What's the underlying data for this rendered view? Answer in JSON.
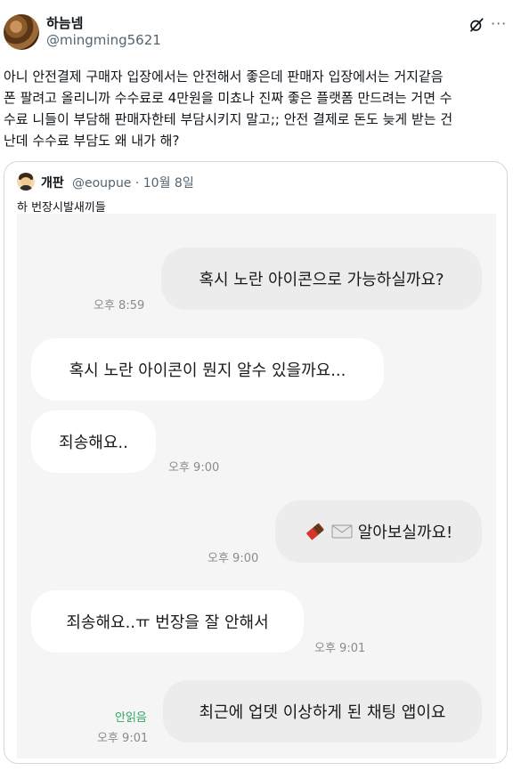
{
  "post": {
    "author_name": "하늠넴",
    "author_handle": "@mingming5621",
    "text": "아니 안전결제 구매자 입장에서는 안전해서 좋은데 판매자 입장에서는 거지같음\n폰 팔려고 올리니까 수수료로 4만원을 미쵸나 진짜 좋은 플랫폼 만드려는 거면 수\n수료 니들이 부담해 판매자한테 부담시키지 말고;; 안전 결제로 돈도 늦게 받는 건\n난데 수수료 부담도 왜 내가 해?"
  },
  "quote": {
    "author_name": "개판",
    "author_handle": "@eoupue · 10월 8일",
    "text": "하 번장시발새끼들",
    "chat": [
      {
        "side": "out",
        "text": "혹시 노란 아이콘으로 가능하실까요?",
        "time": "오후 8:59"
      },
      {
        "side": "in",
        "text": "혹시 노란 아이콘이 뭔지 알수 있을까요...",
        "time": ""
      },
      {
        "side": "in",
        "text": "죄송해요..",
        "time": "오후 9:00"
      },
      {
        "side": "out",
        "text": "알아보실까요!",
        "time": "오후 9:00",
        "icons": [
          "chocolate-icon",
          "envelope-icon"
        ]
      },
      {
        "side": "in",
        "text": "죄송해요..ㅠ 번장을 잘 안해서",
        "time": "오후 9:01"
      },
      {
        "side": "out",
        "text": "최근에 업뎃 이상하게 된 채팅 앱이요",
        "time": "오후 9:01",
        "read": "안읽음"
      }
    ]
  },
  "icons": {
    "grok": "grok-icon",
    "more": "more-icon"
  },
  "colors": {
    "read_receipt": "#2fa866",
    "bubble_out": "#ececec",
    "bubble_in": "#ffffff",
    "chat_bg": "#f5f5f5"
  }
}
